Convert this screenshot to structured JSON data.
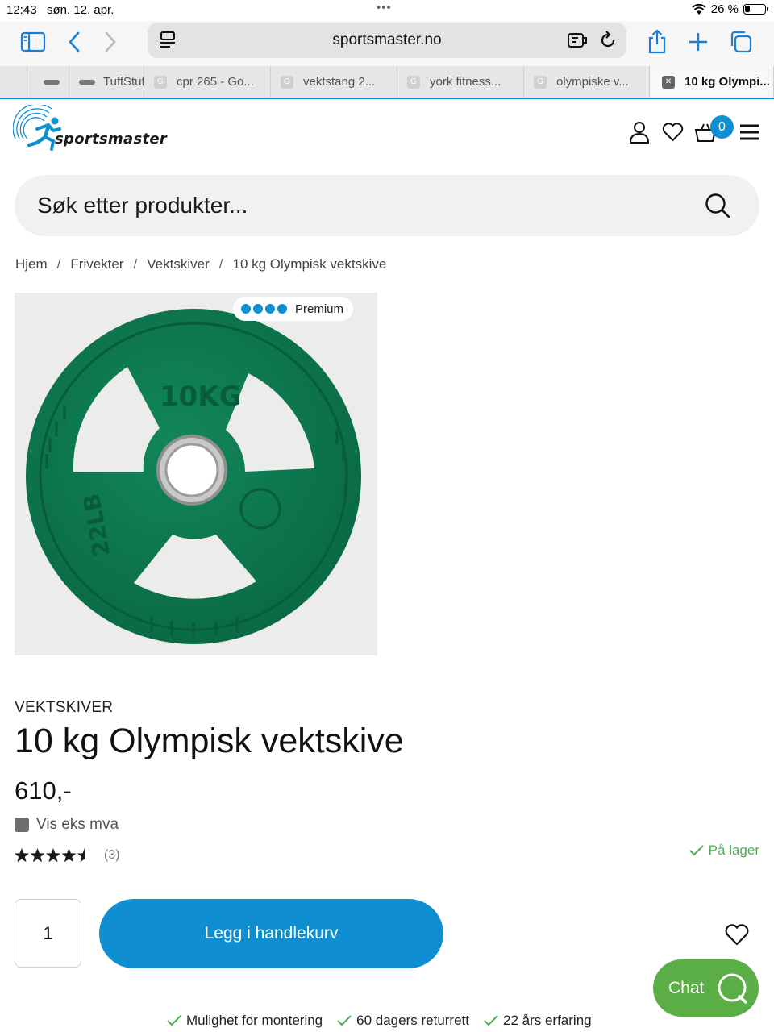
{
  "status_bar": {
    "time": "12:43",
    "date": "søn. 12. apr.",
    "battery_text": "26 %",
    "battery_level": 0.26
  },
  "browser": {
    "url": "sportsmaster.no",
    "tabs": [
      {
        "label": "",
        "favicon": "bar-icon"
      },
      {
        "label": "TuffStuf",
        "favicon": "bar-icon"
      },
      {
        "label": "cpr 265 - Go...",
        "favicon": "google-g-icon"
      },
      {
        "label": "vektstang 2...",
        "favicon": "google-g-icon"
      },
      {
        "label": "york fitness...",
        "favicon": "google-g-icon"
      },
      {
        "label": "olympiske v...",
        "favicon": "google-g-icon"
      },
      {
        "label": "10 kg Olympi...",
        "favicon": "close-icon",
        "active": true
      }
    ]
  },
  "site": {
    "logo_text": "sportsmaster",
    "cart_count": "0",
    "search": {
      "placeholder": "Søk etter produkter..."
    },
    "breadcrumb": [
      "Hjem",
      "Frivekter",
      "Vektskiver",
      "10 kg Olympisk vektskive"
    ]
  },
  "product": {
    "badge": "Premium",
    "image_text": {
      "weight_kg": "10KG",
      "weight_lb": "22LB"
    },
    "category": "VEKTSKIVER",
    "title": "10 kg Olympisk vektskive",
    "price": "610,-",
    "vat_toggle_label": "Vis eks mva",
    "rating": {
      "stars": 4.5,
      "max": 5,
      "count": "(3)"
    },
    "stock": "På lager",
    "quantity": "1",
    "add_to_cart_label": "Legg i handlekurv"
  },
  "chat": {
    "label": "Chat"
  },
  "usps": [
    "Mulighet for montering",
    "60 dagers returrett",
    "22 års erfaring"
  ],
  "colors": {
    "brand_blue": "#0f8ed1",
    "chat_green": "#5bad45",
    "stock_green": "#4caf50",
    "plate_green": "#0d7a4f"
  }
}
